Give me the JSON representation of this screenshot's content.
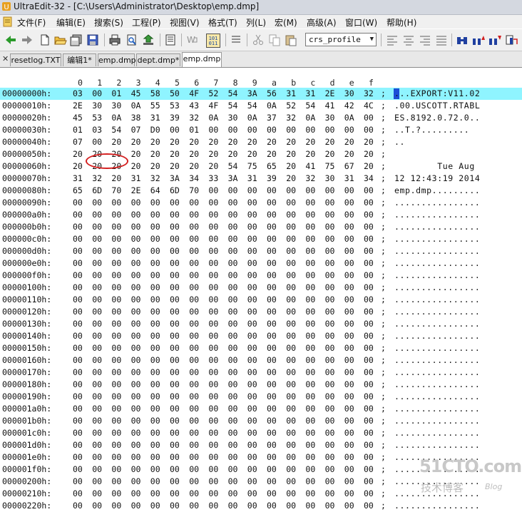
{
  "title": "UltraEdit-32 - [C:\\Users\\Administrator\\Desktop\\emp.dmp]",
  "menu": [
    "文件(F)",
    "编辑(E)",
    "搜索(S)",
    "工程(P)",
    "视图(V)",
    "格式(T)",
    "列(L)",
    "宏(M)",
    "高级(A)",
    "窗口(W)",
    "帮助(H)"
  ],
  "toolbar": {
    "config_value": "crs_profile",
    "left_buttons": [
      "back-arrow-icon",
      "forward-arrow-icon",
      "new-file-icon",
      "open-file-icon",
      "save-icon",
      "save-all-icon",
      "print-icon",
      "print-preview-icon",
      "ftp-icon",
      "find-in-files-icon",
      "word-wrap-icon",
      "hex-toggle-icon",
      "text-format-icon",
      "cut-icon",
      "copy-icon",
      "paste-icon",
      "undo-icon",
      "redo-icon",
      "zoom-icon"
    ],
    "right_buttons": [
      "align-left-icon",
      "align-center-icon",
      "align-right-icon",
      "justify-icon",
      "find-icon",
      "find-next-icon",
      "find-prev-icon",
      "replace-icon"
    ]
  },
  "tabs": [
    {
      "label": "resetlog.TXT",
      "active": false
    },
    {
      "label": "编辑1*",
      "active": false
    },
    {
      "label": "emp.dmp",
      "active": false
    },
    {
      "label": "dept.dmp*",
      "active": false
    },
    {
      "label": "emp.dmp",
      "active": true
    }
  ],
  "hex": {
    "column_headers": [
      "0",
      "1",
      "2",
      "3",
      "4",
      "5",
      "6",
      "7",
      "8",
      "9",
      "a",
      "b",
      "c",
      "d",
      "e",
      "f"
    ],
    "rows": [
      {
        "addr": "00000000h:",
        "bytes": [
          "03",
          "00",
          "01",
          "45",
          "58",
          "50",
          "4F",
          "52",
          "54",
          "3A",
          "56",
          "31",
          "31",
          "2E",
          "30",
          "32"
        ],
        "ascii": "...EXPORT:V11.02",
        "highlight": true
      },
      {
        "addr": "00000010h:",
        "bytes": [
          "2E",
          "30",
          "30",
          "0A",
          "55",
          "53",
          "43",
          "4F",
          "54",
          "54",
          "0A",
          "52",
          "54",
          "41",
          "42",
          "4C"
        ],
        "ascii": ".00.USCOTT.RTABL"
      },
      {
        "addr": "00000020h:",
        "bytes": [
          "45",
          "53",
          "0A",
          "38",
          "31",
          "39",
          "32",
          "0A",
          "30",
          "0A",
          "37",
          "32",
          "0A",
          "30",
          "0A",
          "00"
        ],
        "ascii": "ES.8192.0.72.0.."
      },
      {
        "addr": "00000030h:",
        "bytes": [
          "01",
          "03",
          "54",
          "07",
          "D0",
          "00",
          "01",
          "00",
          "00",
          "00",
          "00",
          "00",
          "00",
          "00",
          "00",
          "00"
        ],
        "ascii": "..T.?........."
      },
      {
        "addr": "00000040h:",
        "bytes": [
          "07",
          "00",
          "20",
          "20",
          "20",
          "20",
          "20",
          "20",
          "20",
          "20",
          "20",
          "20",
          "20",
          "20",
          "20",
          "20"
        ],
        "ascii": ".."
      },
      {
        "addr": "00000050h:",
        "bytes": [
          "20",
          "20",
          "20",
          "20",
          "20",
          "20",
          "20",
          "20",
          "20",
          "20",
          "20",
          "20",
          "20",
          "20",
          "20",
          "20"
        ],
        "ascii": ""
      },
      {
        "addr": "00000060h:",
        "bytes": [
          "20",
          "20",
          "20",
          "20",
          "20",
          "20",
          "20",
          "20",
          "54",
          "75",
          "65",
          "20",
          "41",
          "75",
          "67",
          "20"
        ],
        "ascii": "        Tue Aug "
      },
      {
        "addr": "00000070h:",
        "bytes": [
          "31",
          "32",
          "20",
          "31",
          "32",
          "3A",
          "34",
          "33",
          "3A",
          "31",
          "39",
          "20",
          "32",
          "30",
          "31",
          "34"
        ],
        "ascii": "12 12:43:19 2014"
      },
      {
        "addr": "00000080h:",
        "bytes": [
          "65",
          "6D",
          "70",
          "2E",
          "64",
          "6D",
          "70",
          "00",
          "00",
          "00",
          "00",
          "00",
          "00",
          "00",
          "00",
          "00"
        ],
        "ascii": "emp.dmp........."
      },
      {
        "addr": "00000090h:",
        "bytes": [
          "00",
          "00",
          "00",
          "00",
          "00",
          "00",
          "00",
          "00",
          "00",
          "00",
          "00",
          "00",
          "00",
          "00",
          "00",
          "00"
        ],
        "ascii": "................"
      },
      {
        "addr": "000000a0h:",
        "bytes": [
          "00",
          "00",
          "00",
          "00",
          "00",
          "00",
          "00",
          "00",
          "00",
          "00",
          "00",
          "00",
          "00",
          "00",
          "00",
          "00"
        ],
        "ascii": "................"
      },
      {
        "addr": "000000b0h:",
        "bytes": [
          "00",
          "00",
          "00",
          "00",
          "00",
          "00",
          "00",
          "00",
          "00",
          "00",
          "00",
          "00",
          "00",
          "00",
          "00",
          "00"
        ],
        "ascii": "................"
      },
      {
        "addr": "000000c0h:",
        "bytes": [
          "00",
          "00",
          "00",
          "00",
          "00",
          "00",
          "00",
          "00",
          "00",
          "00",
          "00",
          "00",
          "00",
          "00",
          "00",
          "00"
        ],
        "ascii": "................"
      },
      {
        "addr": "000000d0h:",
        "bytes": [
          "00",
          "00",
          "00",
          "00",
          "00",
          "00",
          "00",
          "00",
          "00",
          "00",
          "00",
          "00",
          "00",
          "00",
          "00",
          "00"
        ],
        "ascii": "................"
      },
      {
        "addr": "000000e0h:",
        "bytes": [
          "00",
          "00",
          "00",
          "00",
          "00",
          "00",
          "00",
          "00",
          "00",
          "00",
          "00",
          "00",
          "00",
          "00",
          "00",
          "00"
        ],
        "ascii": "................"
      },
      {
        "addr": "000000f0h:",
        "bytes": [
          "00",
          "00",
          "00",
          "00",
          "00",
          "00",
          "00",
          "00",
          "00",
          "00",
          "00",
          "00",
          "00",
          "00",
          "00",
          "00"
        ],
        "ascii": "................"
      },
      {
        "addr": "00000100h:",
        "bytes": [
          "00",
          "00",
          "00",
          "00",
          "00",
          "00",
          "00",
          "00",
          "00",
          "00",
          "00",
          "00",
          "00",
          "00",
          "00",
          "00"
        ],
        "ascii": "................"
      },
      {
        "addr": "00000110h:",
        "bytes": [
          "00",
          "00",
          "00",
          "00",
          "00",
          "00",
          "00",
          "00",
          "00",
          "00",
          "00",
          "00",
          "00",
          "00",
          "00",
          "00"
        ],
        "ascii": "................"
      },
      {
        "addr": "00000120h:",
        "bytes": [
          "00",
          "00",
          "00",
          "00",
          "00",
          "00",
          "00",
          "00",
          "00",
          "00",
          "00",
          "00",
          "00",
          "00",
          "00",
          "00"
        ],
        "ascii": "................"
      },
      {
        "addr": "00000130h:",
        "bytes": [
          "00",
          "00",
          "00",
          "00",
          "00",
          "00",
          "00",
          "00",
          "00",
          "00",
          "00",
          "00",
          "00",
          "00",
          "00",
          "00"
        ],
        "ascii": "................"
      },
      {
        "addr": "00000140h:",
        "bytes": [
          "00",
          "00",
          "00",
          "00",
          "00",
          "00",
          "00",
          "00",
          "00",
          "00",
          "00",
          "00",
          "00",
          "00",
          "00",
          "00"
        ],
        "ascii": "................"
      },
      {
        "addr": "00000150h:",
        "bytes": [
          "00",
          "00",
          "00",
          "00",
          "00",
          "00",
          "00",
          "00",
          "00",
          "00",
          "00",
          "00",
          "00",
          "00",
          "00",
          "00"
        ],
        "ascii": "................"
      },
      {
        "addr": "00000160h:",
        "bytes": [
          "00",
          "00",
          "00",
          "00",
          "00",
          "00",
          "00",
          "00",
          "00",
          "00",
          "00",
          "00",
          "00",
          "00",
          "00",
          "00"
        ],
        "ascii": "................"
      },
      {
        "addr": "00000170h:",
        "bytes": [
          "00",
          "00",
          "00",
          "00",
          "00",
          "00",
          "00",
          "00",
          "00",
          "00",
          "00",
          "00",
          "00",
          "00",
          "00",
          "00"
        ],
        "ascii": "................"
      },
      {
        "addr": "00000180h:",
        "bytes": [
          "00",
          "00",
          "00",
          "00",
          "00",
          "00",
          "00",
          "00",
          "00",
          "00",
          "00",
          "00",
          "00",
          "00",
          "00",
          "00"
        ],
        "ascii": "................"
      },
      {
        "addr": "00000190h:",
        "bytes": [
          "00",
          "00",
          "00",
          "00",
          "00",
          "00",
          "00",
          "00",
          "00",
          "00",
          "00",
          "00",
          "00",
          "00",
          "00",
          "00"
        ],
        "ascii": "................"
      },
      {
        "addr": "000001a0h:",
        "bytes": [
          "00",
          "00",
          "00",
          "00",
          "00",
          "00",
          "00",
          "00",
          "00",
          "00",
          "00",
          "00",
          "00",
          "00",
          "00",
          "00"
        ],
        "ascii": "................"
      },
      {
        "addr": "000001b0h:",
        "bytes": [
          "00",
          "00",
          "00",
          "00",
          "00",
          "00",
          "00",
          "00",
          "00",
          "00",
          "00",
          "00",
          "00",
          "00",
          "00",
          "00"
        ],
        "ascii": "................"
      },
      {
        "addr": "000001c0h:",
        "bytes": [
          "00",
          "00",
          "00",
          "00",
          "00",
          "00",
          "00",
          "00",
          "00",
          "00",
          "00",
          "00",
          "00",
          "00",
          "00",
          "00"
        ],
        "ascii": "................"
      },
      {
        "addr": "000001d0h:",
        "bytes": [
          "00",
          "00",
          "00",
          "00",
          "00",
          "00",
          "00",
          "00",
          "00",
          "00",
          "00",
          "00",
          "00",
          "00",
          "00",
          "00"
        ],
        "ascii": "................"
      },
      {
        "addr": "000001e0h:",
        "bytes": [
          "00",
          "00",
          "00",
          "00",
          "00",
          "00",
          "00",
          "00",
          "00",
          "00",
          "00",
          "00",
          "00",
          "00",
          "00",
          "00"
        ],
        "ascii": "................"
      },
      {
        "addr": "000001f0h:",
        "bytes": [
          "00",
          "00",
          "00",
          "00",
          "00",
          "00",
          "00",
          "00",
          "00",
          "00",
          "00",
          "00",
          "00",
          "00",
          "00",
          "00"
        ],
        "ascii": "................"
      },
      {
        "addr": "00000200h:",
        "bytes": [
          "00",
          "00",
          "00",
          "00",
          "00",
          "00",
          "00",
          "00",
          "00",
          "00",
          "00",
          "00",
          "00",
          "00",
          "00",
          "00"
        ],
        "ascii": "................"
      },
      {
        "addr": "00000210h:",
        "bytes": [
          "00",
          "00",
          "00",
          "00",
          "00",
          "00",
          "00",
          "00",
          "00",
          "00",
          "00",
          "00",
          "00",
          "00",
          "00",
          "00"
        ],
        "ascii": "................"
      },
      {
        "addr": "00000220h:",
        "bytes": [
          "00",
          "00",
          "00",
          "00",
          "00",
          "00",
          "00",
          "00",
          "00",
          "00",
          "00",
          "00",
          "00",
          "00",
          "00",
          "00"
        ],
        "ascii": "................"
      }
    ]
  },
  "watermark": {
    "main": "51CTO.com",
    "sub": "技术博客",
    "blog": "Blog"
  },
  "colors": {
    "highlight_row": "#8ff4ff",
    "annotation": "#d42020",
    "cursor": "#1c4fd6"
  }
}
